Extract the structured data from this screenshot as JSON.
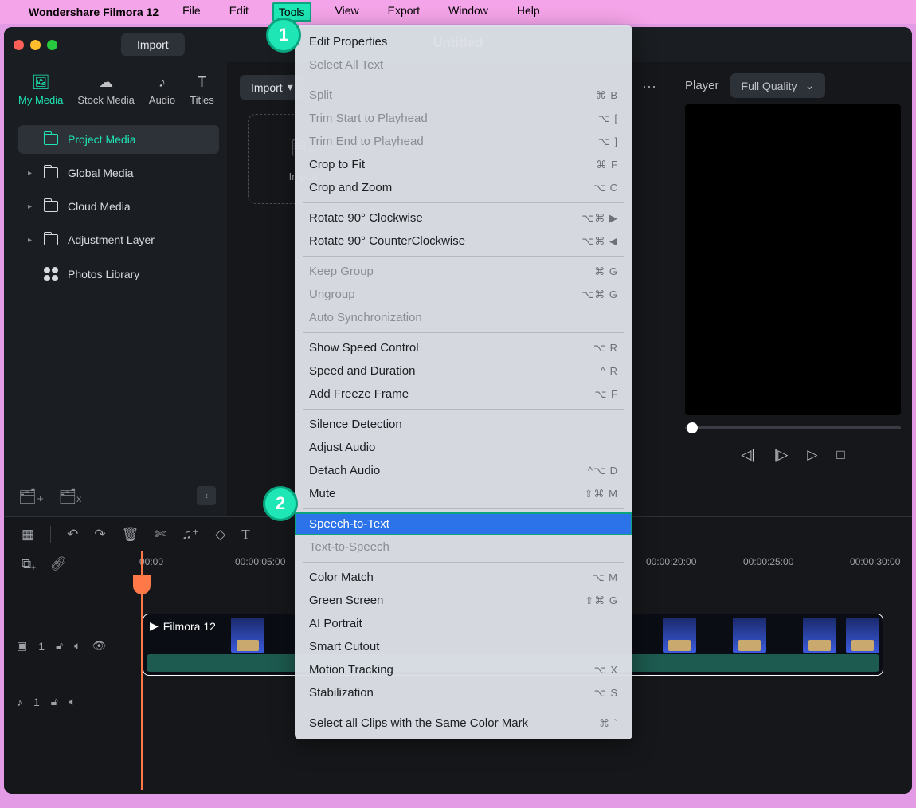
{
  "menubar": {
    "app_name": "Wondershare Filmora 12",
    "items": [
      "File",
      "Edit",
      "Tools",
      "View",
      "Export",
      "Window",
      "Help"
    ],
    "active_index": 2
  },
  "window": {
    "import_btn": "Import",
    "doc_title": "Untitled"
  },
  "tabs": [
    {
      "icon": "media",
      "label": "My Media",
      "active": true
    },
    {
      "icon": "stock",
      "label": "Stock Media"
    },
    {
      "icon": "audio",
      "label": "Audio"
    },
    {
      "icon": "titles",
      "label": "Titles"
    }
  ],
  "sidebar": [
    {
      "label": "Project Media",
      "active": true,
      "arrow": false,
      "icon": "folder"
    },
    {
      "label": "Global Media",
      "arrow": true,
      "icon": "folder"
    },
    {
      "label": "Cloud Media",
      "arrow": true,
      "icon": "folder"
    },
    {
      "label": "Adjustment Layer",
      "arrow": true,
      "icon": "folder"
    },
    {
      "label": "Photos Library",
      "arrow": false,
      "icon": "grid"
    }
  ],
  "mid": {
    "import_label": "Import",
    "drop_label": "Import"
  },
  "player": {
    "label": "Player",
    "quality": "Full Quality"
  },
  "ruler": [
    "00:00",
    "00:00:05:00",
    "00:00:20:00",
    "00:00:25:00",
    "00:00:30:00"
  ],
  "ruler_pos": [
    0,
    120,
    636,
    758,
    892
  ],
  "clip_name": "Filmora 12",
  "track1_num": "1",
  "track2_num": "1",
  "badges": {
    "b1": "1",
    "b2": "2"
  },
  "dropdown": [
    {
      "t": "item",
      "label": "Edit Properties"
    },
    {
      "t": "item",
      "label": "Select All Text",
      "disabled": true
    },
    {
      "t": "sep"
    },
    {
      "t": "item",
      "label": "Split",
      "shortcut": "⌘ B",
      "disabled": true
    },
    {
      "t": "item",
      "label": "Trim Start to Playhead",
      "shortcut": "⌥ [",
      "disabled": true
    },
    {
      "t": "item",
      "label": "Trim End to Playhead",
      "shortcut": "⌥ ]",
      "disabled": true
    },
    {
      "t": "item",
      "label": "Crop to Fit",
      "shortcut": "⌘ F"
    },
    {
      "t": "item",
      "label": "Crop and Zoom",
      "shortcut": "⌥ C"
    },
    {
      "t": "sep"
    },
    {
      "t": "item",
      "label": "Rotate 90° Clockwise",
      "shortcut": "⌥⌘ ▶"
    },
    {
      "t": "item",
      "label": "Rotate 90° CounterClockwise",
      "shortcut": "⌥⌘ ◀"
    },
    {
      "t": "sep"
    },
    {
      "t": "item",
      "label": "Keep Group",
      "shortcut": "⌘ G",
      "disabled": true
    },
    {
      "t": "item",
      "label": "Ungroup",
      "shortcut": "⌥⌘ G",
      "disabled": true
    },
    {
      "t": "item",
      "label": "Auto Synchronization",
      "disabled": true
    },
    {
      "t": "sep"
    },
    {
      "t": "item",
      "label": "Show Speed Control",
      "shortcut": "⌥ R"
    },
    {
      "t": "item",
      "label": "Speed and Duration",
      "shortcut": "^ R"
    },
    {
      "t": "item",
      "label": "Add Freeze Frame",
      "shortcut": "⌥ F"
    },
    {
      "t": "sep"
    },
    {
      "t": "item",
      "label": "Silence Detection"
    },
    {
      "t": "item",
      "label": "Adjust Audio"
    },
    {
      "t": "item",
      "label": "Detach Audio",
      "shortcut": "^⌥ D"
    },
    {
      "t": "item",
      "label": "Mute",
      "shortcut": "⇧⌘ M"
    },
    {
      "t": "sep"
    },
    {
      "t": "item",
      "label": "Speech-to-Text",
      "highlighted": true,
      "boxed": true
    },
    {
      "t": "item",
      "label": "Text-to-Speech",
      "disabled": true
    },
    {
      "t": "sep"
    },
    {
      "t": "item",
      "label": "Color Match",
      "shortcut": "⌥ M"
    },
    {
      "t": "item",
      "label": "Green Screen",
      "shortcut": "⇧⌘ G"
    },
    {
      "t": "item",
      "label": "AI Portrait"
    },
    {
      "t": "item",
      "label": "Smart Cutout"
    },
    {
      "t": "item",
      "label": "Motion Tracking",
      "shortcut": "⌥ X"
    },
    {
      "t": "item",
      "label": "Stabilization",
      "shortcut": "⌥ S"
    },
    {
      "t": "sep"
    },
    {
      "t": "item",
      "label": "Select all Clips with the Same Color Mark",
      "shortcut": "⌘ `"
    }
  ]
}
